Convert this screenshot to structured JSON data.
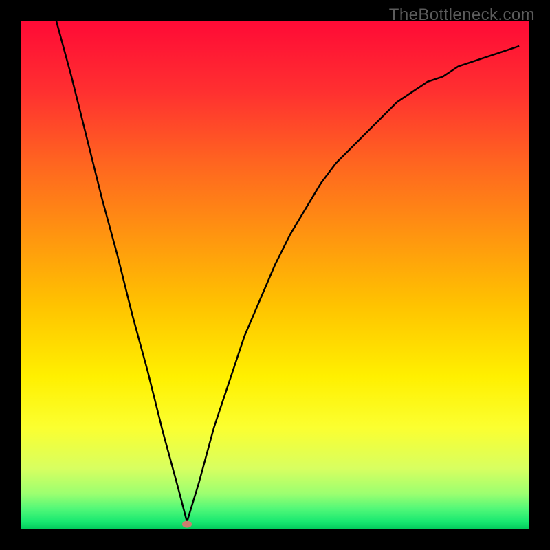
{
  "watermark": "TheBottleneck.com",
  "chart_data": {
    "type": "line",
    "title": "",
    "xlabel": "",
    "ylabel": "",
    "xlim": [
      0,
      100
    ],
    "ylim": [
      0,
      100
    ],
    "grid": false,
    "legend": false,
    "background": "gradient red→orange→yellow→limegreen→green (top→bottom)",
    "series": [
      {
        "name": "bottleneck-curve",
        "color": "#000000",
        "x": [
          7,
          10,
          13,
          16,
          19,
          22,
          25,
          28,
          31,
          32.7,
          35,
          38,
          41,
          44,
          47,
          50,
          53,
          56,
          59,
          62,
          65,
          68,
          71,
          74,
          77,
          80,
          83,
          86,
          89,
          92,
          95,
          98
        ],
        "y": [
          100,
          89,
          77,
          65,
          54,
          42,
          31,
          19,
          8,
          1.5,
          9,
          20,
          29,
          38,
          45,
          52,
          58,
          63,
          68,
          72,
          75,
          78,
          81,
          84,
          86,
          88,
          89,
          91,
          92,
          93,
          94,
          95
        ]
      }
    ],
    "marker": {
      "name": "optimal-point",
      "x": 32.7,
      "y": 1.0,
      "color": "#cc7d6f",
      "rx": 7,
      "ry": 5
    }
  }
}
